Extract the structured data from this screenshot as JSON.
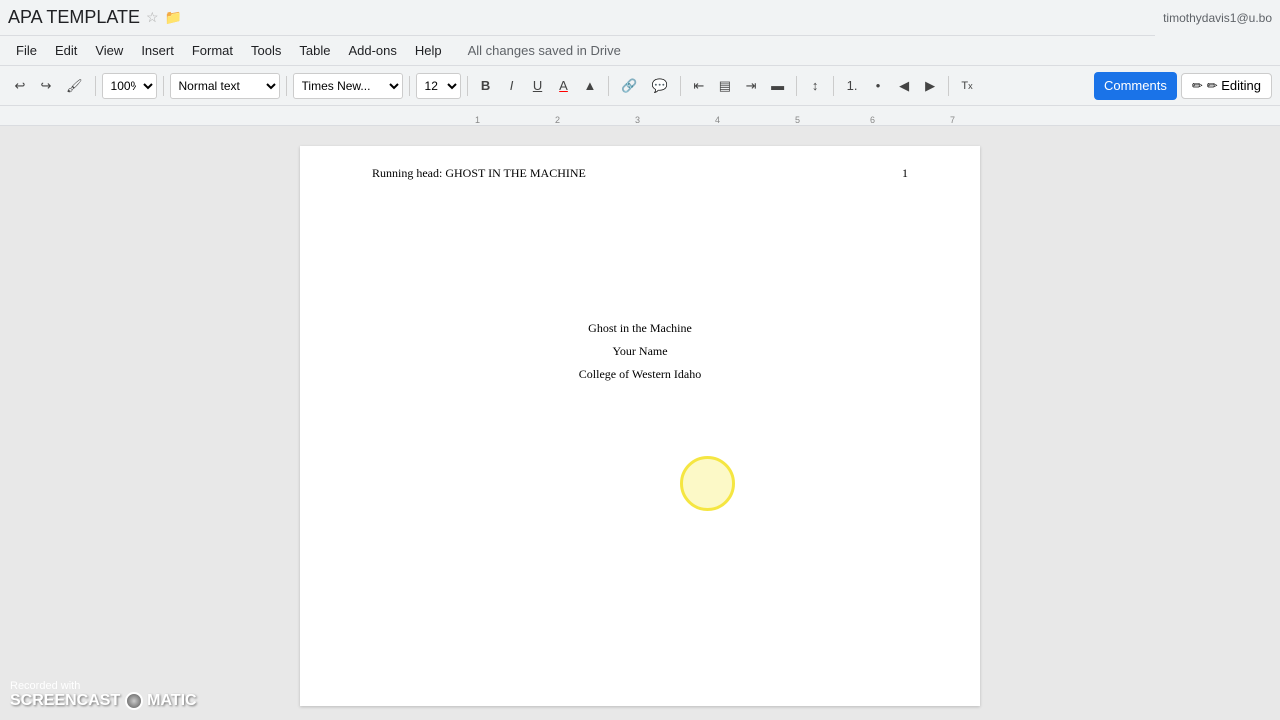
{
  "titlebar": {
    "doc_title": "APA TEMPLATE",
    "star_icon": "☆",
    "folder_icon": "📁",
    "user_email": "timothydavis1@u.bo"
  },
  "menubar": {
    "items": [
      "File",
      "Edit",
      "View",
      "Insert",
      "Format",
      "Tools",
      "Table",
      "Add-ons",
      "Help"
    ],
    "autosave": "All changes saved in Drive"
  },
  "toolbar": {
    "undo_label": "↩",
    "redo_label": "↪",
    "paint_label": "🖌",
    "zoom_value": "100%",
    "style_value": "Normal text",
    "font_value": "Times New...",
    "size_value": "12",
    "bold_label": "B",
    "italic_label": "I",
    "underline_label": "U",
    "text_color_label": "A",
    "highlight_label": "▲",
    "link_label": "🔗",
    "comment_label": "💬",
    "align_left_label": "≡",
    "align_center_label": "≡",
    "align_right_label": "≡",
    "align_justify_label": "≡",
    "line_spacing_label": "↕",
    "ordered_list_label": "1.",
    "unordered_list_label": "•",
    "decrease_indent_label": "◀",
    "increase_indent_label": "▶",
    "clear_format_label": "Tx",
    "editing_label": "✏ Editing",
    "comments_btn_label": "Comments"
  },
  "document": {
    "running_head": "Running head: GHOST IN THE MACHINE",
    "page_number": "1",
    "title_line": "Ghost in the Machine",
    "author_line": "Your Name",
    "institution_line": "College of Western Idaho"
  },
  "watermark": {
    "top_line": "Recorded with",
    "bottom_line": "SCREENCAST◉MATIC"
  }
}
